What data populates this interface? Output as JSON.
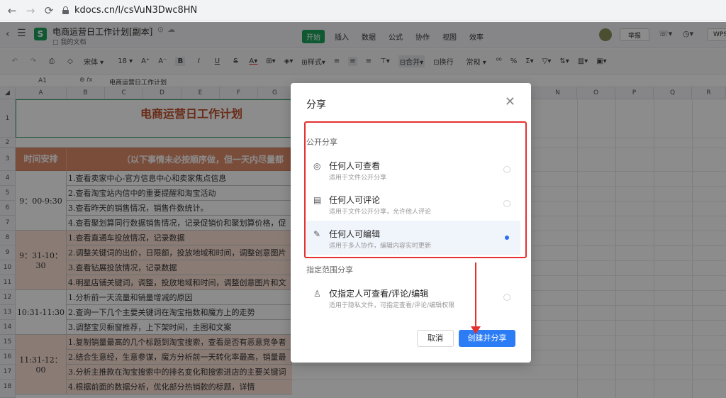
{
  "browser": {
    "url": "kdocs.cn/l/csVuN3Dwc8HN"
  },
  "app": {
    "doc_title": "电商运营日工作计划[副本]",
    "doc_location": "我的文档",
    "tabs": [
      "开始",
      "插入",
      "数据",
      "公式",
      "协作",
      "视图",
      "效率"
    ],
    "report_label": "举报",
    "wps_label": "WPS"
  },
  "toolbar": {
    "font_name": "宋体",
    "font_size": "18",
    "style_label": "样式",
    "merge_label": "合并",
    "wrap_label": "换行",
    "format_label": "常规"
  },
  "formula_bar": {
    "cell_ref": "A1",
    "content": "电商运营日工作计划"
  },
  "sheet": {
    "columns": [
      "A",
      "B",
      "C",
      "D",
      "E",
      "F",
      "G",
      "N",
      "O",
      "P",
      "Q",
      "R"
    ],
    "rows": [
      "1",
      "2",
      "3",
      "4",
      "5",
      "6",
      "7",
      "8",
      "9",
      "10",
      "11",
      "12",
      "13",
      "14",
      "15",
      "16",
      "17",
      "18"
    ],
    "title": "电商运营日工作计划",
    "header_time": "时间安排",
    "header_note": "（以下事情未必按顺序做，但一天内尽量都",
    "time_slots": [
      "9：00-9:30",
      "9：31-10：30",
      "10:31-11:30",
      "11:31-12：00"
    ],
    "tasks": [
      "1.查看卖家中心-官方信息中心和卖家焦点信息",
      "2.查看淘宝站内信中的重要提醒和淘宝活动",
      "3.查看昨天的销售情况，销售件数统计。",
      "4.查看聚划算同行数据销售情况，记录促销价和聚划算价格，促",
      "1.查看直通车投放情况，记录数据",
      "2.调整关键词的出价，日限额，投放地域和时间，调整创意图片",
      "3.查看钻展投放情况，记录数据",
      "4.明星店铺关键词，调整，投放地域和时间，调整创意图片和文",
      "1.分析前一天流量和销量增减的原因",
      "2.查询一下几个主要关键词在淘宝指数和魔方上的走势",
      "3.调整宝贝橱窗推荐，上下架时间，主图和文案",
      "1.复制销量最高的几个标题到淘宝搜索，查看是否有恶意竞争者",
      "2.结合生意经，生意参谋，魔方分析前一天转化率最高，销量最",
      "3.分析主推款在淘宝搜索中的排名变化和搜索进店的主要关键词",
      "4.根据前面的数据分析，优化部分热销款的标题，详情"
    ]
  },
  "dialog": {
    "title": "分享",
    "public_section": "公开分享",
    "options": [
      {
        "title": "任何人可查看",
        "desc": "适用于文件公开分享"
      },
      {
        "title": "任何人可评论",
        "desc": "适用于文件公开分享，允许他人评论"
      },
      {
        "title": "任何人可编辑",
        "desc": "适用于多人协作，编辑内容实时更新"
      }
    ],
    "restricted_section": "指定范围分享",
    "restricted_option": {
      "title": "仅指定人可查看/评论/编辑",
      "desc": "适用于隐私文件，可指定查看/评论/编辑权限"
    },
    "cancel_label": "取消",
    "create_label": "创建并分享"
  },
  "colors": {
    "brand_green": "#1aa35a",
    "primary_blue": "#2c7cf6",
    "annotation_red": "#e53030",
    "header_orange": "#df8d6c",
    "title_red": "#c0502d"
  }
}
